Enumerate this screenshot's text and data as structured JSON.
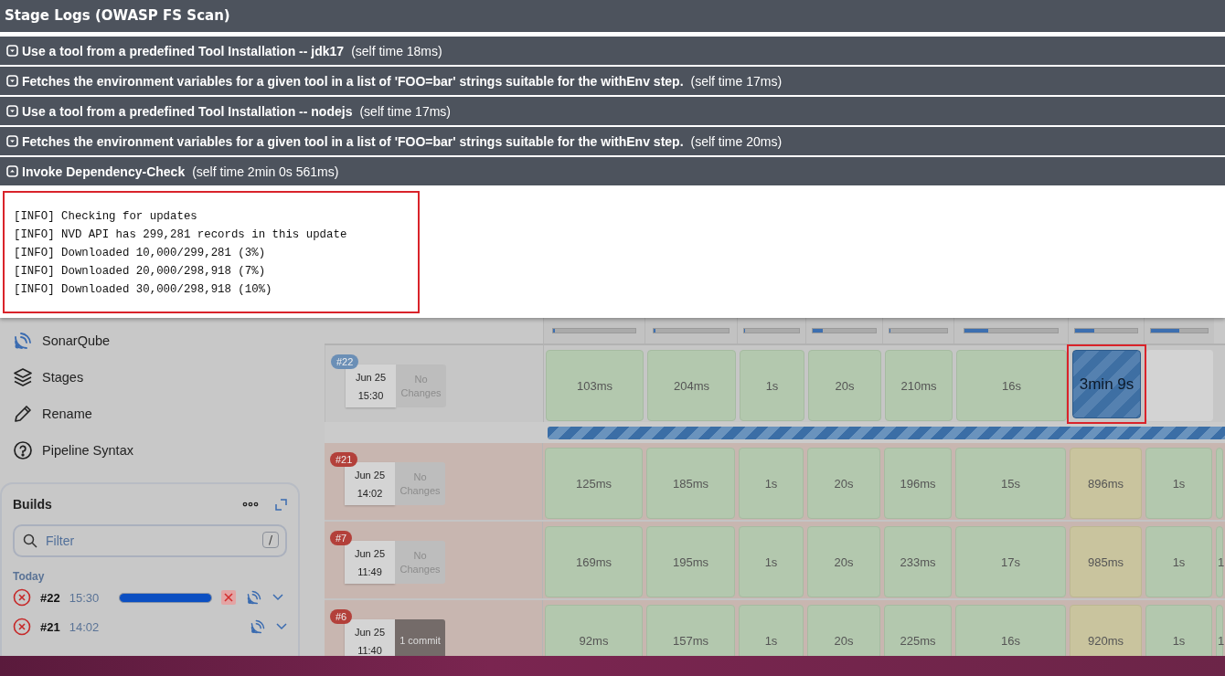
{
  "log_modal": {
    "title": "Stage Logs (OWASP FS Scan)",
    "steps": [
      {
        "label": "Use a tool from a predefined Tool Installation -- jdk17",
        "time": "(self time 18ms)",
        "expanded": false
      },
      {
        "label": "Fetches the environment variables for a given tool in a list of 'FOO=bar' strings suitable for the withEnv step.",
        "time": "(self time 17ms)",
        "expanded": false
      },
      {
        "label": "Use a tool from a predefined Tool Installation -- nodejs",
        "time": "(self time 17ms)",
        "expanded": false
      },
      {
        "label": "Fetches the environment variables for a given tool in a list of 'FOO=bar' strings suitable for the withEnv step.",
        "time": "(self time 20ms)",
        "expanded": false
      },
      {
        "label": "Invoke Dependency-Check",
        "time": "(self time 2min 0s 561ms)",
        "expanded": true
      }
    ],
    "console": {
      "highlighted": true,
      "lines": [
        "[INFO] Checking for updates",
        "[INFO] NVD API has 299,281 records in this update",
        "[INFO] Downloaded 10,000/299,281 (3%)",
        "[INFO] Downloaded 20,000/298,918 (7%)",
        "[INFO] Downloaded 30,000/298,918 (10%)"
      ]
    }
  },
  "sidebar": {
    "items": [
      {
        "label": "SonarQube"
      },
      {
        "label": "Stages"
      },
      {
        "label": "Rename"
      },
      {
        "label": "Pipeline Syntax"
      }
    ],
    "builds": {
      "title": "Builds",
      "filter": {
        "placeholder": "Filter",
        "shortcut": "/"
      },
      "group": "Today",
      "items": [
        {
          "number": "#22",
          "time": "15:30",
          "running": true,
          "level": 1
        },
        {
          "number": "#21",
          "time": "14:02",
          "running": false
        }
      ]
    }
  },
  "stage_view": {
    "header_bars": [
      {
        "level": 0.02
      },
      {
        "level": 0.02
      },
      {
        "level": 0.02
      },
      {
        "level": 0.15
      },
      {
        "level": 0.02
      },
      {
        "level": 0.25
      },
      {
        "level": 0.3
      },
      {
        "level": 0.5
      }
    ],
    "builds": [
      {
        "badge": "#22",
        "kind": "running",
        "date": "Jun 25",
        "time": "15:30",
        "changes": "No Changes",
        "has_commits": false,
        "cells": [
          {
            "text": "103ms",
            "kind": "success"
          },
          {
            "text": "204ms",
            "kind": "success"
          },
          {
            "text": "1s",
            "kind": "success"
          },
          {
            "text": "20s",
            "kind": "success"
          },
          {
            "text": "210ms",
            "kind": "success"
          },
          {
            "text": "16s",
            "kind": "success"
          },
          {
            "text": "3min 9s",
            "kind": "running",
            "highlighted": true
          },
          {
            "kind": "pending"
          }
        ]
      },
      {
        "badge": "#21",
        "kind": "failed",
        "date": "Jun 25",
        "time": "14:02",
        "changes": "No Changes",
        "has_commits": false,
        "cells": [
          {
            "text": "125ms",
            "kind": "success"
          },
          {
            "text": "185ms",
            "kind": "success"
          },
          {
            "text": "1s",
            "kind": "success"
          },
          {
            "text": "20s",
            "kind": "success"
          },
          {
            "text": "196ms",
            "kind": "success"
          },
          {
            "text": "15s",
            "kind": "success"
          },
          {
            "text": "896ms",
            "kind": "unstable"
          },
          {
            "text": "1s",
            "kind": "success"
          },
          {
            "kind": "success"
          }
        ]
      },
      {
        "badge": "#7",
        "kind": "failed",
        "date": "Jun 25",
        "time": "11:49",
        "changes": "No Changes",
        "has_commits": false,
        "cells": [
          {
            "text": "169ms",
            "kind": "success"
          },
          {
            "text": "195ms",
            "kind": "success"
          },
          {
            "text": "1s",
            "kind": "success"
          },
          {
            "text": "20s",
            "kind": "success"
          },
          {
            "text": "233ms",
            "kind": "success"
          },
          {
            "text": "17s",
            "kind": "success"
          },
          {
            "text": "985ms",
            "kind": "unstable"
          },
          {
            "text": "1s",
            "kind": "success"
          },
          {
            "text": "1",
            "kind": "success"
          }
        ]
      },
      {
        "badge": "#6",
        "kind": "failed",
        "date": "Jun 25",
        "time": "11:40",
        "changes": "1 commit",
        "has_commits": true,
        "cells": [
          {
            "text": "92ms",
            "kind": "success"
          },
          {
            "text": "157ms",
            "kind": "success"
          },
          {
            "text": "1s",
            "kind": "success"
          },
          {
            "text": "20s",
            "kind": "success"
          },
          {
            "text": "225ms",
            "kind": "success"
          },
          {
            "text": "16s",
            "kind": "success"
          },
          {
            "text": "920ms",
            "kind": "unstable"
          },
          {
            "text": "1s",
            "kind": "success"
          },
          {
            "text": "1",
            "kind": "success"
          }
        ]
      }
    ]
  }
}
